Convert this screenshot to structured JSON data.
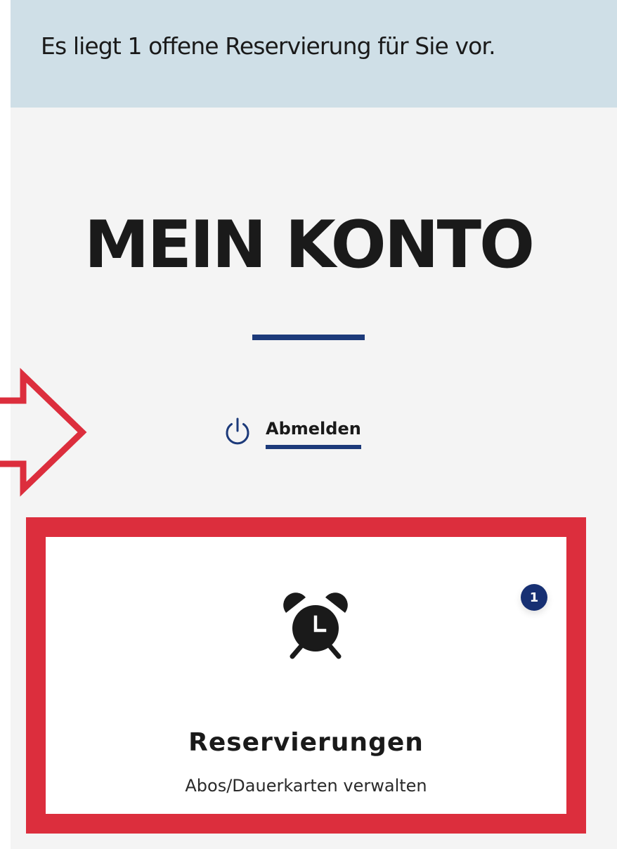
{
  "notice": {
    "text": "Es liegt 1 offene Reservierung für Sie vor."
  },
  "page": {
    "title": "MEIN KONTO"
  },
  "logout": {
    "label": "Abmelden",
    "icon": "power-icon"
  },
  "card": {
    "icon": "alarm-clock-icon",
    "title": "Reservierungen",
    "subtitle": "Abos/Dauerkarten verwalten",
    "badge_count": "1"
  },
  "colors": {
    "accent": "#1c3a7a",
    "annotation_red": "#dc2e3d",
    "notice_bg": "#cfdfe7",
    "page_bg": "#f4f4f4"
  }
}
